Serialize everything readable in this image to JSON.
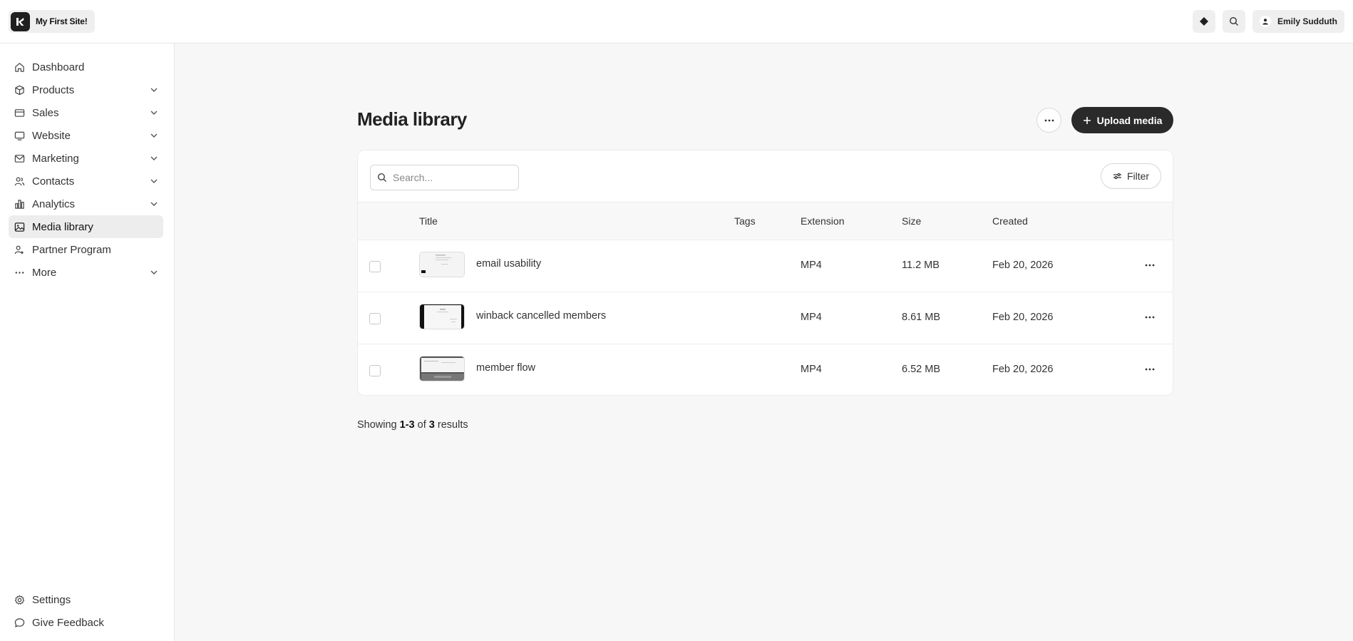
{
  "header": {
    "site_name": "My First Site!",
    "user_name": "Emily Sudduth"
  },
  "sidebar": {
    "items": [
      {
        "label": "Dashboard",
        "icon": "home-icon",
        "expandable": false
      },
      {
        "label": "Products",
        "icon": "box-icon",
        "expandable": true
      },
      {
        "label": "Sales",
        "icon": "credit-card-icon",
        "expandable": true
      },
      {
        "label": "Website",
        "icon": "monitor-icon",
        "expandable": true
      },
      {
        "label": "Marketing",
        "icon": "mail-icon",
        "expandable": true
      },
      {
        "label": "Contacts",
        "icon": "users-icon",
        "expandable": true
      },
      {
        "label": "Analytics",
        "icon": "bar-chart-icon",
        "expandable": true
      },
      {
        "label": "Media library",
        "icon": "image-icon",
        "expandable": false,
        "active": true
      },
      {
        "label": "Partner Program",
        "icon": "partner-icon",
        "expandable": false
      },
      {
        "label": "More",
        "icon": "dots-icon",
        "expandable": true
      }
    ],
    "bottom": [
      {
        "label": "Settings",
        "icon": "gear-icon"
      },
      {
        "label": "Give Feedback",
        "icon": "chat-bubble-icon"
      }
    ]
  },
  "main": {
    "title": "Media library",
    "upload_label": "Upload media",
    "search_placeholder": "Search...",
    "filter_label": "Filter",
    "columns": [
      "Title",
      "Tags",
      "Extension",
      "Size",
      "Created"
    ],
    "rows": [
      {
        "title": "email usability",
        "tags": "",
        "extension": "MP4",
        "size": "11.2 MB",
        "created": "Feb 20, 2026"
      },
      {
        "title": "winback cancelled members",
        "tags": "",
        "extension": "MP4",
        "size": "8.61 MB",
        "created": "Feb 20, 2026"
      },
      {
        "title": "member flow",
        "tags": "",
        "extension": "MP4",
        "size": "6.52 MB",
        "created": "Feb 20, 2026"
      }
    ],
    "showing": {
      "prefix": "Showing",
      "range": "1-3",
      "of": "of",
      "total": "3",
      "suffix": "results"
    }
  }
}
